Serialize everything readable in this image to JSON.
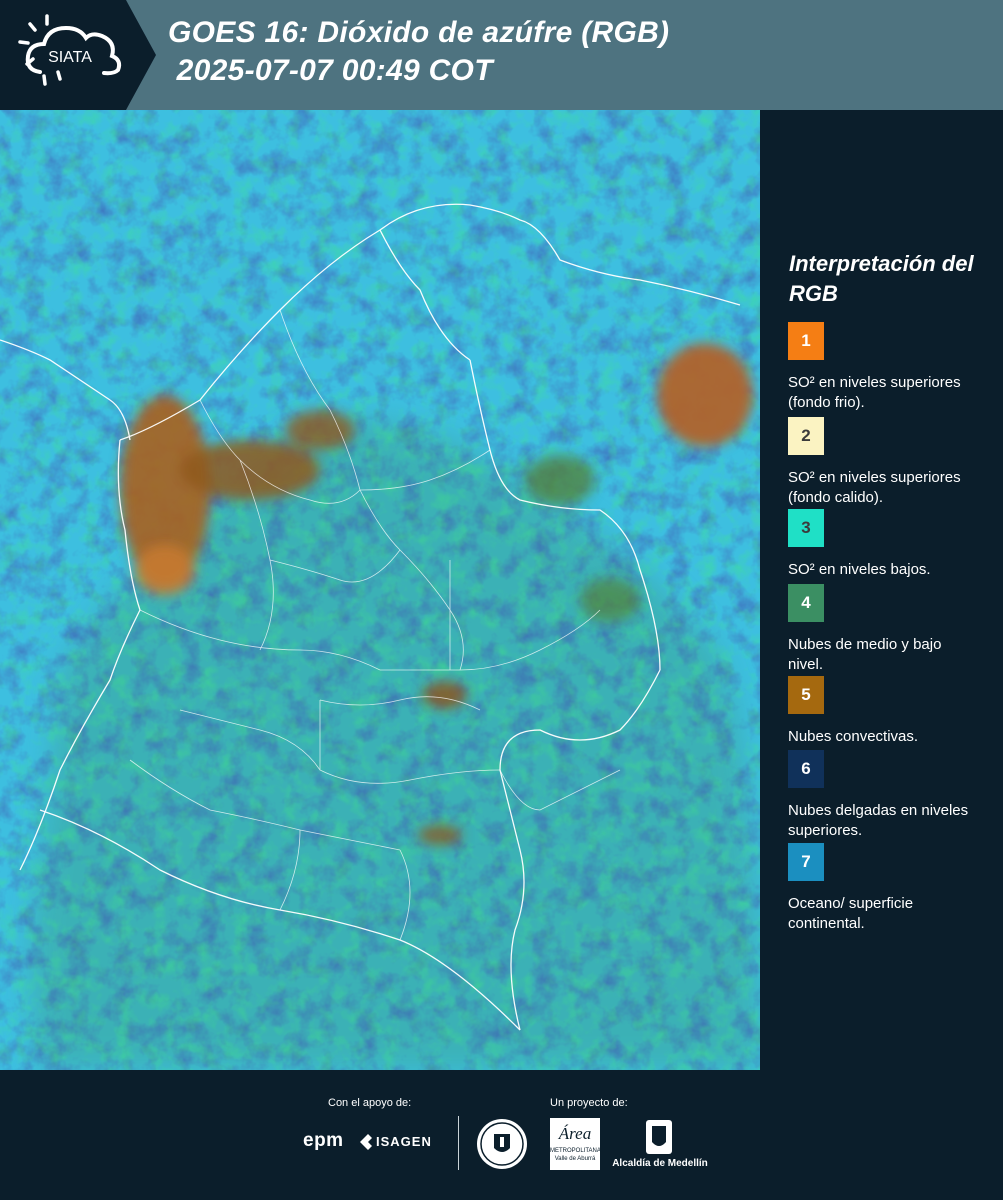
{
  "header": {
    "logo_text": "SIATA",
    "title_line1": "GOES 16: Dióxido de azúfre (RGB)",
    "title_line2": " 2025-07-07 00:49 COT"
  },
  "legend": {
    "title": "Interpretación del RGB",
    "items": [
      {
        "number": "1",
        "color": "#f57e14",
        "label": "SO² en niveles superiores (fondo frio)."
      },
      {
        "number": "2",
        "color": "#fbf3c2",
        "label": "SO² en niveles superiores (fondo calido)."
      },
      {
        "number": "3",
        "color": "#1fe0c6",
        "label": "SO² en niveles bajos."
      },
      {
        "number": "4",
        "color": "#3b8f63",
        "label": "Nubes de medio y bajo nivel."
      },
      {
        "number": "5",
        "color": "#a5690f",
        "label": "Nubes convectivas."
      },
      {
        "number": "6",
        "color": "#10315a",
        "label": "Nubes delgadas en niveles superiores."
      },
      {
        "number": "7",
        "color": "#1b8fc0",
        "label": "Oceano/ superficie continental."
      }
    ]
  },
  "footer": {
    "support_label": "Con el apoyo de:",
    "project_label": "Un proyecto de:",
    "sponsor1": "epm",
    "sponsor2": "ISAGEN",
    "partner1": "Universidad de Medellín",
    "partner2_name": "Área",
    "partner2_sub1": "METROPOLITANA",
    "partner2_sub2": "Valle de Aburrá",
    "partner3": "Alcaldía de Medellín"
  },
  "colors": {
    "header_bg": "#4e7380",
    "panel_bg": "#0b1e2b",
    "ocean": "#3dbfe0"
  }
}
